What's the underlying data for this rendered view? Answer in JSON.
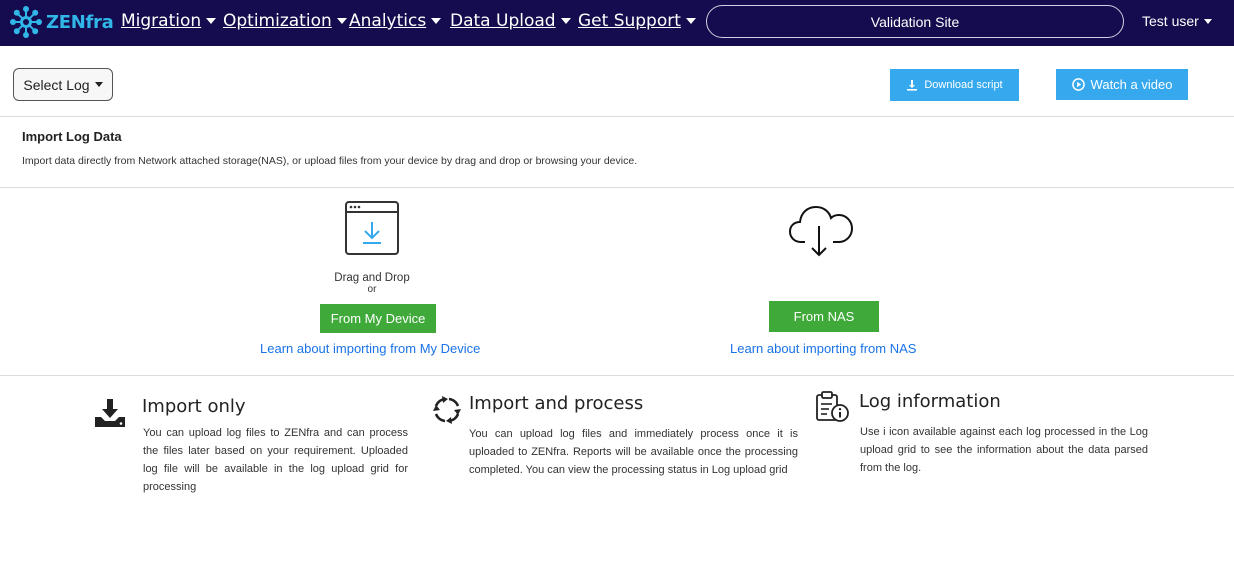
{
  "navbar": {
    "logo_text": "ZENfra",
    "menu": [
      {
        "label": "Migration"
      },
      {
        "label": "Optimization"
      },
      {
        "label": "Analytics"
      },
      {
        "label": "Data Upload"
      },
      {
        "label": "Get Support"
      }
    ],
    "site": "Validation Site",
    "user": "Test user"
  },
  "toolbar": {
    "select_log": "Select Log",
    "download_script": "Download script",
    "watch_video": "Watch a video"
  },
  "import_section": {
    "title": "Import Log Data",
    "subtitle": "Import data directly from Network attached storage(NAS), or upload files from your device by drag and drop or browsing your device."
  },
  "device_option": {
    "drag_drop": "Drag and Drop",
    "or": "or",
    "button": "From My Device",
    "link": "Learn about importing from My Device"
  },
  "nas_option": {
    "button": "From NAS",
    "link": "Learn about importing from NAS"
  },
  "info": [
    {
      "title": "Import only",
      "text": "You can upload log files to ZENfra and can process the files later based on your requirement. Uploaded log file will be available in the log upload grid for processing"
    },
    {
      "title": "Import and process",
      "text": "You can upload log files and immediately process once it is uploaded to ZENfra. Reports will be available once the processing completed. You can view the processing status in Log upload grid"
    },
    {
      "title": "Log information",
      "text": "Use i icon available against each log processed in the Log upload grid to see the information about the data parsed from the log."
    }
  ],
  "colors": {
    "navbar_bg": "#140c4e",
    "logo_accent": "#31b6e8",
    "primary_button": "#36a9ee",
    "success_button": "#3faa3a",
    "link": "#1a73e8"
  }
}
